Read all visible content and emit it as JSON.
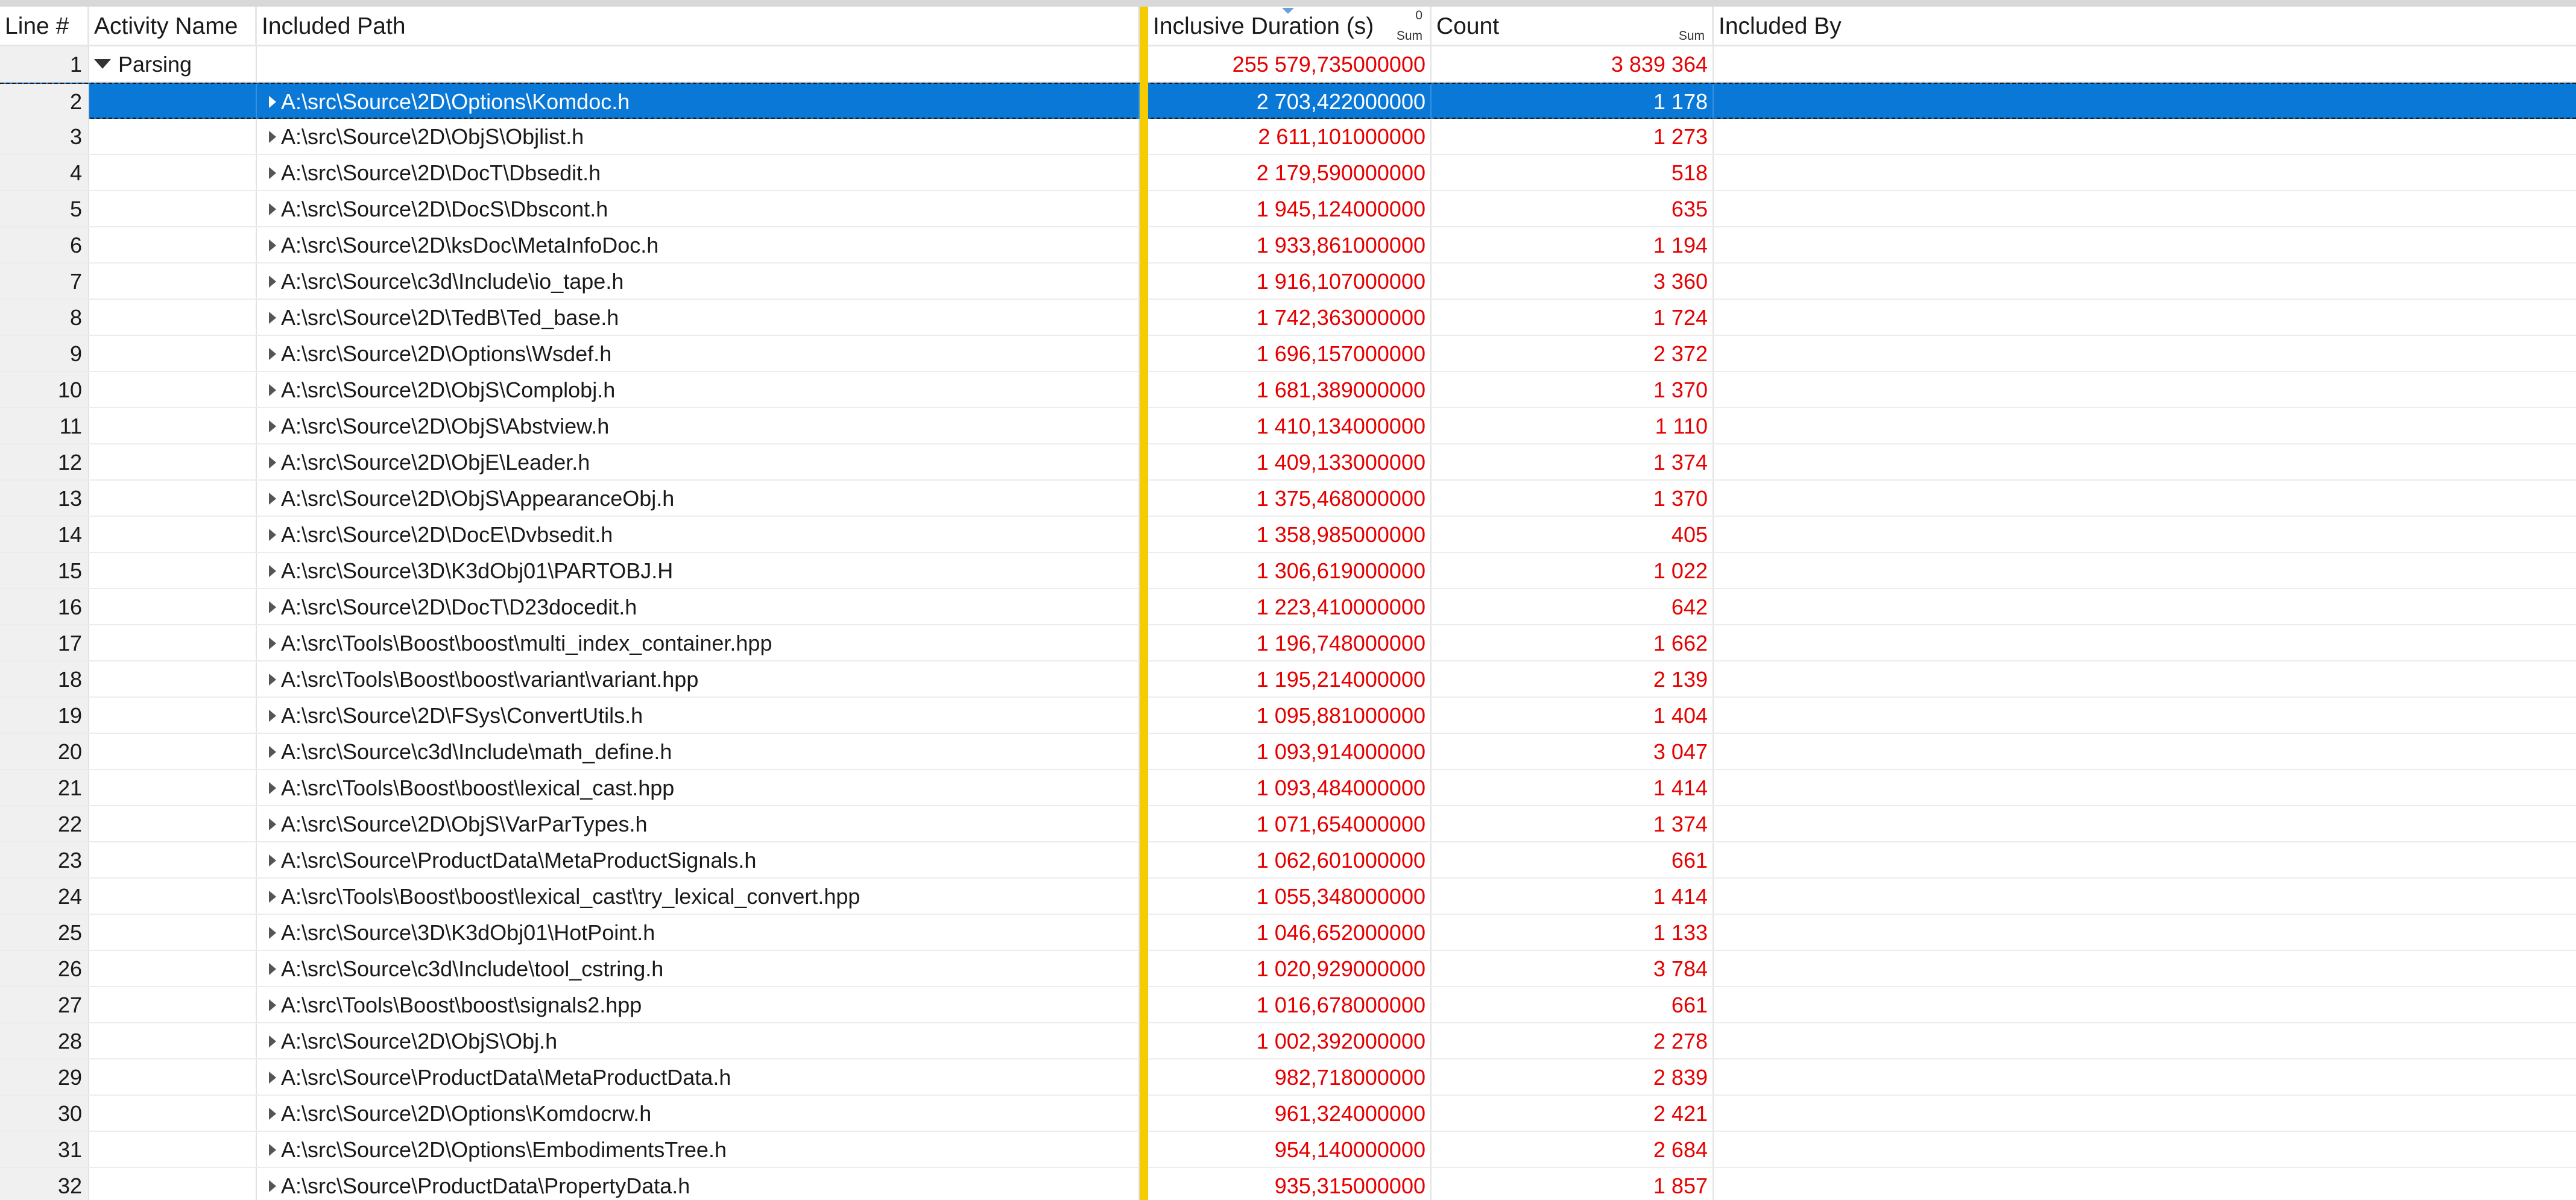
{
  "columns": [
    {
      "label": "Line #"
    },
    {
      "label": "Activity Name"
    },
    {
      "label": "Included Path"
    },
    {
      "label": "Inclusive Duration (s)",
      "sum_label": "Sum",
      "sort_index": "0"
    },
    {
      "label": "Count",
      "sum_label": "Sum"
    },
    {
      "label": "Included By"
    }
  ],
  "colors": {
    "selection": "#0a78d7",
    "numeric_text": "#e60000",
    "splitter": "#f5cc00",
    "line_number_background": "#f0f0f0"
  },
  "icons": {
    "expanded": "triangle-down-icon",
    "collapsed": "triangle-right-icon",
    "sort": "sort-descending-icon"
  },
  "rows": [
    {
      "line": "1",
      "activity": "Parsing",
      "path": "",
      "duration": "255 579,735000000",
      "count": "3 839 364",
      "expanded": true
    },
    {
      "line": "2",
      "activity": "",
      "path": "A:\\src\\Source\\2D\\Options\\Komdoc.h",
      "duration": "2 703,422000000",
      "count": "1 178",
      "selected": true
    },
    {
      "line": "3",
      "activity": "",
      "path": "A:\\src\\Source\\2D\\ObjS\\Objlist.h",
      "duration": "2 611,101000000",
      "count": "1 273"
    },
    {
      "line": "4",
      "activity": "",
      "path": "A:\\src\\Source\\2D\\DocT\\Dbsedit.h",
      "duration": "2 179,590000000",
      "count": "518"
    },
    {
      "line": "5",
      "activity": "",
      "path": "A:\\src\\Source\\2D\\DocS\\Dbscont.h",
      "duration": "1 945,124000000",
      "count": "635"
    },
    {
      "line": "6",
      "activity": "",
      "path": "A:\\src\\Source\\2D\\ksDoc\\MetaInfoDoc.h",
      "duration": "1 933,861000000",
      "count": "1 194"
    },
    {
      "line": "7",
      "activity": "",
      "path": "A:\\src\\Source\\c3d\\Include\\io_tape.h",
      "duration": "1 916,107000000",
      "count": "3 360"
    },
    {
      "line": "8",
      "activity": "",
      "path": "A:\\src\\Source\\2D\\TedB\\Ted_base.h",
      "duration": "1 742,363000000",
      "count": "1 724"
    },
    {
      "line": "9",
      "activity": "",
      "path": "A:\\src\\Source\\2D\\Options\\Wsdef.h",
      "duration": "1 696,157000000",
      "count": "2 372"
    },
    {
      "line": "10",
      "activity": "",
      "path": "A:\\src\\Source\\2D\\ObjS\\Complobj.h",
      "duration": "1 681,389000000",
      "count": "1 370"
    },
    {
      "line": "11",
      "activity": "",
      "path": "A:\\src\\Source\\2D\\ObjS\\Abstview.h",
      "duration": "1 410,134000000",
      "count": "1 110"
    },
    {
      "line": "12",
      "activity": "",
      "path": "A:\\src\\Source\\2D\\ObjE\\Leader.h",
      "duration": "1 409,133000000",
      "count": "1 374"
    },
    {
      "line": "13",
      "activity": "",
      "path": "A:\\src\\Source\\2D\\ObjS\\AppearanceObj.h",
      "duration": "1 375,468000000",
      "count": "1 370"
    },
    {
      "line": "14",
      "activity": "",
      "path": "A:\\src\\Source\\2D\\DocE\\Dvbsedit.h",
      "duration": "1 358,985000000",
      "count": "405"
    },
    {
      "line": "15",
      "activity": "",
      "path": "A:\\src\\Source\\3D\\K3dObj01\\PARTOBJ.H",
      "duration": "1 306,619000000",
      "count": "1 022"
    },
    {
      "line": "16",
      "activity": "",
      "path": "A:\\src\\Source\\2D\\DocT\\D23docedit.h",
      "duration": "1 223,410000000",
      "count": "642"
    },
    {
      "line": "17",
      "activity": "",
      "path": "A:\\src\\Tools\\Boost\\boost\\multi_index_container.hpp",
      "duration": "1 196,748000000",
      "count": "1 662"
    },
    {
      "line": "18",
      "activity": "",
      "path": "A:\\src\\Tools\\Boost\\boost\\variant\\variant.hpp",
      "duration": "1 195,214000000",
      "count": "2 139"
    },
    {
      "line": "19",
      "activity": "",
      "path": "A:\\src\\Source\\2D\\FSys\\ConvertUtils.h",
      "duration": "1 095,881000000",
      "count": "1 404"
    },
    {
      "line": "20",
      "activity": "",
      "path": "A:\\src\\Source\\c3d\\Include\\math_define.h",
      "duration": "1 093,914000000",
      "count": "3 047"
    },
    {
      "line": "21",
      "activity": "",
      "path": "A:\\src\\Tools\\Boost\\boost\\lexical_cast.hpp",
      "duration": "1 093,484000000",
      "count": "1 414"
    },
    {
      "line": "22",
      "activity": "",
      "path": "A:\\src\\Source\\2D\\ObjS\\VarParTypes.h",
      "duration": "1 071,654000000",
      "count": "1 374"
    },
    {
      "line": "23",
      "activity": "",
      "path": "A:\\src\\Source\\ProductData\\MetaProductSignals.h",
      "duration": "1 062,601000000",
      "count": "661"
    },
    {
      "line": "24",
      "activity": "",
      "path": "A:\\src\\Tools\\Boost\\boost\\lexical_cast\\try_lexical_convert.hpp",
      "duration": "1 055,348000000",
      "count": "1 414"
    },
    {
      "line": "25",
      "activity": "",
      "path": "A:\\src\\Source\\3D\\K3dObj01\\HotPoint.h",
      "duration": "1 046,652000000",
      "count": "1 133"
    },
    {
      "line": "26",
      "activity": "",
      "path": "A:\\src\\Source\\c3d\\Include\\tool_cstring.h",
      "duration": "1 020,929000000",
      "count": "3 784"
    },
    {
      "line": "27",
      "activity": "",
      "path": "A:\\src\\Tools\\Boost\\boost\\signals2.hpp",
      "duration": "1 016,678000000",
      "count": "661"
    },
    {
      "line": "28",
      "activity": "",
      "path": "A:\\src\\Source\\2D\\ObjS\\Obj.h",
      "duration": "1 002,392000000",
      "count": "2 278"
    },
    {
      "line": "29",
      "activity": "",
      "path": "A:\\src\\Source\\ProductData\\MetaProductData.h",
      "duration": "982,718000000",
      "count": "2 839"
    },
    {
      "line": "30",
      "activity": "",
      "path": "A:\\src\\Source\\2D\\Options\\Komdocrw.h",
      "duration": "961,324000000",
      "count": "2 421"
    },
    {
      "line": "31",
      "activity": "",
      "path": "A:\\src\\Source\\2D\\Options\\EmbodimentsTree.h",
      "duration": "954,140000000",
      "count": "2 684"
    },
    {
      "line": "32",
      "activity": "",
      "path": "A:\\src\\Source\\ProductData\\PropertyData.h",
      "duration": "935,315000000",
      "count": "1 857"
    }
  ]
}
